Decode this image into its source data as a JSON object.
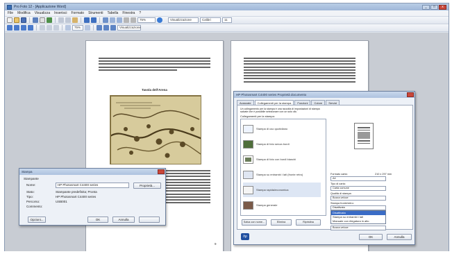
{
  "window": {
    "title": "Pro Foto 12 - [Applicazione Word]",
    "controls": [
      "_",
      "□",
      "x"
    ]
  },
  "menu": {
    "items": [
      "File",
      "Modifica",
      "Visualizza",
      "Inserisci",
      "Formato",
      "Strumenti",
      "Tabella",
      "Finestra",
      "?"
    ]
  },
  "toolbar": {
    "zoom_value": "75%",
    "view_mode": "Visualizzazione",
    "font_name": "Calibri",
    "font_size": "11"
  },
  "left_page": {
    "heading": "Tavola dell'Arena",
    "page_number": "9"
  },
  "print_dialog": {
    "title": "Stampa",
    "group_label": "Stampante",
    "name_label": "Nome:",
    "name_value": "HP Photosmart C4400 series",
    "properties_button": "Proprietà...",
    "rows": [
      {
        "label": "Stato:",
        "value": "Stampante predefinita; Pronta"
      },
      {
        "label": "Tipo:",
        "value": "HP Photosmart C4400 series"
      },
      {
        "label": "Percorso:",
        "value": "USB001"
      },
      {
        "label": "Commento:",
        "value": ""
      }
    ],
    "options_button": "Opzioni...",
    "ok_button": "OK",
    "cancel_button": "Annulla"
  },
  "printer_props": {
    "title": "HP Photosmart C4400 series Proprietà documento",
    "tabs": [
      "Avanzate",
      "Collegamenti per la stampa",
      "Funzioni",
      "Colore",
      "Servizi"
    ],
    "active_tab": 1,
    "intro": "Un collegamento per la stampa è una raccolta di impostazioni di stampa salvate che è possibile selezionare con un solo clic.",
    "list_header": "Collegamenti per la stampa:",
    "shortcuts": [
      "Stampa di uso quotidiano",
      "Stampa di foto senza bordi",
      "Stampa di foto con bordi bianchi",
      "Stampa su entrambi i lati (fronte retro)",
      "Stampa rapida/economica",
      "Stampa generale"
    ],
    "selected_shortcut": 4,
    "right_fields": [
      {
        "label": "Formato carta:",
        "value": "A4",
        "size_hint": "210 x 297 mm"
      },
      {
        "label": "Tipo di carta:",
        "value": "Carta comune"
      },
      {
        "label": "Qualità di stampa:",
        "value": "Bozza veloce"
      },
      {
        "label": "Stampa fronte/retro:",
        "value": "Disattivata"
      },
      {
        "label": "",
        "value": "Bozza veloce"
      }
    ],
    "dropdown_options": [
      "Disattivata",
      "Stampa su entrambi i lati",
      "Manuale con rilegatura in alto"
    ],
    "dropdown_selected": 0,
    "save_as_button": "Salva con nome...",
    "delete_button": "Elimina",
    "reset_button": "Ripristina",
    "ok_button": "OK",
    "cancel_button": "Annulla",
    "brand": "hp"
  }
}
